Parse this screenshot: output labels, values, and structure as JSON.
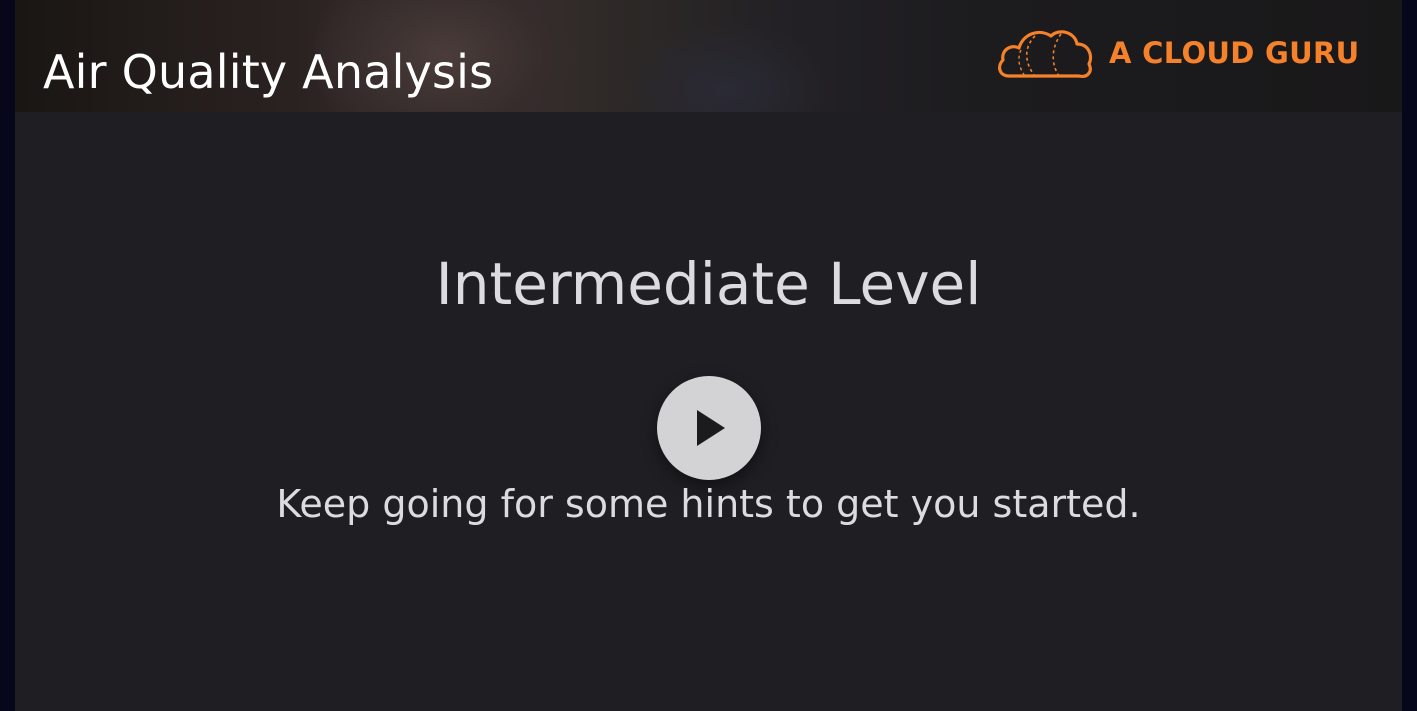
{
  "video": {
    "title": "Air Quality Analysis",
    "brand": {
      "name": "A CLOUD GURU",
      "icon": "cloud-logo-icon",
      "color": "#f5822a"
    },
    "slide": {
      "heading": "Intermediate Level",
      "subtitle": "Keep going for some hints to get you started."
    },
    "controls": {
      "play_icon": "play-icon"
    }
  }
}
